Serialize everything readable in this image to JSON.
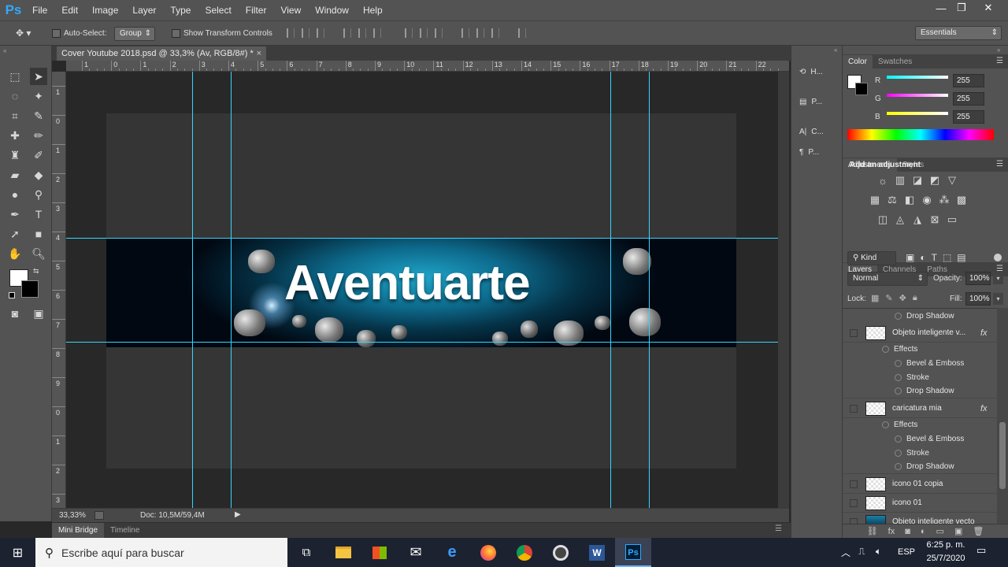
{
  "menubar": {
    "logo": "Ps",
    "items": [
      "File",
      "Edit",
      "Image",
      "Layer",
      "Type",
      "Select",
      "Filter",
      "View",
      "Window",
      "Help"
    ],
    "window_controls": {
      "minimize": "—",
      "restore": "❐",
      "close": "✕"
    }
  },
  "options_bar": {
    "tool_icon": "move-tool-icon",
    "auto_select_label": "Auto-Select:",
    "auto_select_value": "Group",
    "show_transform_label": "Show Transform Controls",
    "workspace": "Essentials"
  },
  "document": {
    "tab_title": "Cover Youtube 2018.psd @ 33,3% (Av, RGB/8#) *",
    "tab_close": "×",
    "banner_text": "Aventuarte",
    "zoom": "33,33%",
    "doc_size": "Doc: 10,5M/59,4M",
    "ruler_top_labels": [
      "1",
      "0",
      "1",
      "2",
      "3",
      "4",
      "5",
      "6",
      "7",
      "8",
      "9",
      "10",
      "11",
      "12",
      "13",
      "14",
      "15",
      "16",
      "17",
      "18",
      "19",
      "20",
      "21",
      "22"
    ],
    "ruler_left_labels": [
      "1",
      "0",
      "1",
      "2",
      "3",
      "4",
      "5",
      "6",
      "7",
      "8",
      "9",
      "0",
      "1",
      "2",
      "3"
    ]
  },
  "bottom_tabs": {
    "mini_bridge": "Mini Bridge",
    "timeline": "Timeline"
  },
  "mid_panel": [
    {
      "icon": "history-icon",
      "label": "H..."
    },
    {
      "icon": "properties-icon",
      "label": "P..."
    },
    {
      "icon": "character-icon",
      "label": "C..."
    },
    {
      "icon": "paragraph-icon",
      "label": "P..."
    }
  ],
  "color_panel": {
    "tabs": [
      "Color",
      "Swatches"
    ],
    "r_label": "R",
    "g_label": "G",
    "b_label": "B",
    "r": "255",
    "g": "255",
    "b": "255"
  },
  "adjustments_panel": {
    "tabs": [
      "Adjustments",
      "Styles"
    ],
    "heading": "Add an adjustment"
  },
  "layers_panel": {
    "tabs": [
      "Layers",
      "Channels",
      "Paths"
    ],
    "kind_filter": "Kind",
    "blend_mode": "Normal",
    "opacity_label": "Opacity:",
    "opacity": "100%",
    "lock_label": "Lock:",
    "fill_label": "Fill:",
    "fill": "100%",
    "rows": {
      "effect_top": "Drop Shadow",
      "layer1": "Objeto inteligente v...",
      "effects1": "Effects",
      "bevel1": "Bevel & Emboss",
      "stroke1": "Stroke",
      "drop1": "Drop Shadow",
      "layer2": "caricatura mia",
      "effects2": "Effects",
      "bevel2": "Bevel & Emboss",
      "stroke2": "Stroke",
      "drop2": "Drop Shadow",
      "layer3": "icono 01 copia",
      "layer4": "icono 01",
      "layer5": "Objeto inteligente vecto"
    },
    "fx": "fx"
  },
  "taskbar": {
    "search_placeholder": "Escribe aquí para buscar",
    "language": "ESP",
    "time": "6:25 p. m.",
    "date": "25/7/2020"
  }
}
